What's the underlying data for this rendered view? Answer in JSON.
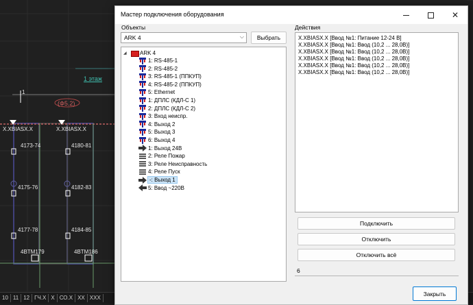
{
  "cad": {
    "labels": [
      "1 этаж",
      "(Ф5.2)",
      "X.XBIASX.X",
      "X.XBIASX.X",
      "4173-74",
      "4180-81",
      "4175-76",
      "4182-83",
      "4177-78",
      "4184-85",
      "4BTM179",
      "4BTM186",
      "1"
    ],
    "status": [
      "10",
      "11",
      "12",
      "ГЧ.Х",
      "X",
      "СО.Х",
      "XX",
      "XXX"
    ]
  },
  "dialog": {
    "title": "Мастер подключения оборудования",
    "minimize_icon": "minimize-icon",
    "maximize_icon": "maximize-icon",
    "close_icon": "close-icon",
    "objects_label": "Объекты",
    "objects_combo": "ARK 4",
    "select_button": "Выбрать",
    "actions_label": "Действия",
    "tree_root": "ARK 4",
    "tree_items": [
      {
        "label": "1: RS-485-1",
        "icon": "interface-icon"
      },
      {
        "label": "2: RS-485-2",
        "icon": "interface-icon"
      },
      {
        "label": "3: RS-485-1 (ППКУП)",
        "icon": "interface-icon"
      },
      {
        "label": "4: RS-485-2 (ППКУП)",
        "icon": "interface-icon"
      },
      {
        "label": "5: Ethernet",
        "icon": "interface-icon"
      },
      {
        "label": "1: ДПЛС (КДЛ-С 1)",
        "icon": "interface-icon"
      },
      {
        "label": "2: ДПЛС (КДЛ-С 2)",
        "icon": "interface-icon"
      },
      {
        "label": "3: Вход неиспр.",
        "icon": "interface-icon"
      },
      {
        "label": "4: Выход 2",
        "icon": "interface-icon"
      },
      {
        "label": "5: Выход 3",
        "icon": "interface-icon"
      },
      {
        "label": "6: Выход 4",
        "icon": "interface-icon"
      },
      {
        "label": "1: Выход 24В",
        "icon": "arrow-right-icon"
      },
      {
        "label": "2: Реле Пожар",
        "icon": "relay-icon"
      },
      {
        "label": "3: Реле Неисправность",
        "icon": "relay-icon"
      },
      {
        "label": "4: Реле Пуск",
        "icon": "relay-icon"
      },
      {
        "label": "-: Выход 1",
        "icon": "arrow-right-icon"
      },
      {
        "label": "5: Ввод ~220В",
        "icon": "arrow-left-icon"
      }
    ],
    "selected_index": 15,
    "actions": [
      "X.XBIASX.X [Ввод №1: Питание 12-24 В]",
      "X.XBIASX.X [Ввод №1: Ввод (10,2 ... 28,0В)]",
      "X.XBIASX.X [Ввод №1: Ввод (10,2 ... 28,0В)]",
      "X.XBIASX.X [Ввод №1: Ввод (10,2 ... 28,0В)]",
      "X.XBIASX.X [Ввод №1: Ввод (10,2 ... 28,0В)]",
      "X.XBIASX.X [Ввод №1: Ввод (10,2 ... 28,0В)]"
    ],
    "connect_button": "Подключить",
    "disconnect_button": "Отключить",
    "disconnect_all_button": "Отключить всё",
    "count": "6",
    "close_button": "Закрыть"
  }
}
